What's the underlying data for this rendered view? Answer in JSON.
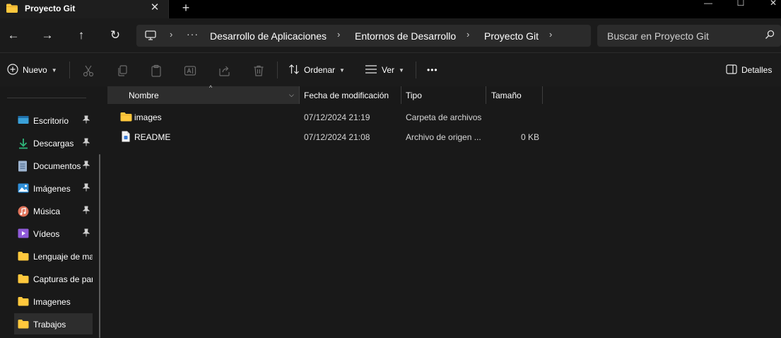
{
  "window": {
    "tab_title": "Proyecto Git",
    "tab_close": "✕",
    "new_tab": "+",
    "controls": {
      "minimize": "—",
      "maximize": "☐",
      "close": "✕"
    }
  },
  "nav": {
    "back": "←",
    "forward": "→",
    "up": "↑",
    "refresh": "↻",
    "breadcrumb_more": "···",
    "crumbs": [
      "Desarrollo de Aplicaciones",
      "Entornos de Desarrollo",
      "Proyecto Git"
    ],
    "separator": "›",
    "search_placeholder": "Buscar en Proyecto Git"
  },
  "toolbar": {
    "new_label": "Nuevo",
    "sort_label": "Ordenar",
    "view_label": "Ver",
    "more_label": "•••",
    "details_label": "Detalles",
    "icons": [
      "cut-icon",
      "copy-icon",
      "paste-icon",
      "rename-icon",
      "share-icon",
      "delete-icon"
    ]
  },
  "sidebar": {
    "items": [
      {
        "label": "Escritorio",
        "icon": "desktop-icon",
        "pinned": true
      },
      {
        "label": "Descargas",
        "icon": "download-icon",
        "pinned": true
      },
      {
        "label": "Documentos",
        "icon": "documents-icon",
        "pinned": true
      },
      {
        "label": "Imágenes",
        "icon": "pictures-icon",
        "pinned": true
      },
      {
        "label": "Música",
        "icon": "music-icon",
        "pinned": true
      },
      {
        "label": "Vídeos",
        "icon": "videos-icon",
        "pinned": true
      },
      {
        "label": "Lenguaje de ma",
        "icon": "folder-icon",
        "pinned": false
      },
      {
        "label": "Capturas de par",
        "icon": "folder-icon",
        "pinned": false
      },
      {
        "label": "Imagenes",
        "icon": "folder-icon",
        "pinned": false
      },
      {
        "label": "Trabajos",
        "icon": "folder-icon",
        "pinned": false,
        "selected": true
      }
    ]
  },
  "files": {
    "columns": [
      "Nombre",
      "Fecha de modificación",
      "Tipo",
      "Tamaño"
    ],
    "sort_indicator": "^",
    "rows": [
      {
        "name": "images",
        "modified": "07/12/2024 21:19",
        "type": "Carpeta de archivos",
        "size": "",
        "icon": "folder-icon"
      },
      {
        "name": "README",
        "modified": "07/12/2024 21:08",
        "type": "Archivo de origen ...",
        "size": "0 KB",
        "icon": "file-icon"
      }
    ]
  },
  "colors": {
    "folder": "#ffc83d",
    "background": "#191919",
    "accent": "#4cc2ff"
  }
}
